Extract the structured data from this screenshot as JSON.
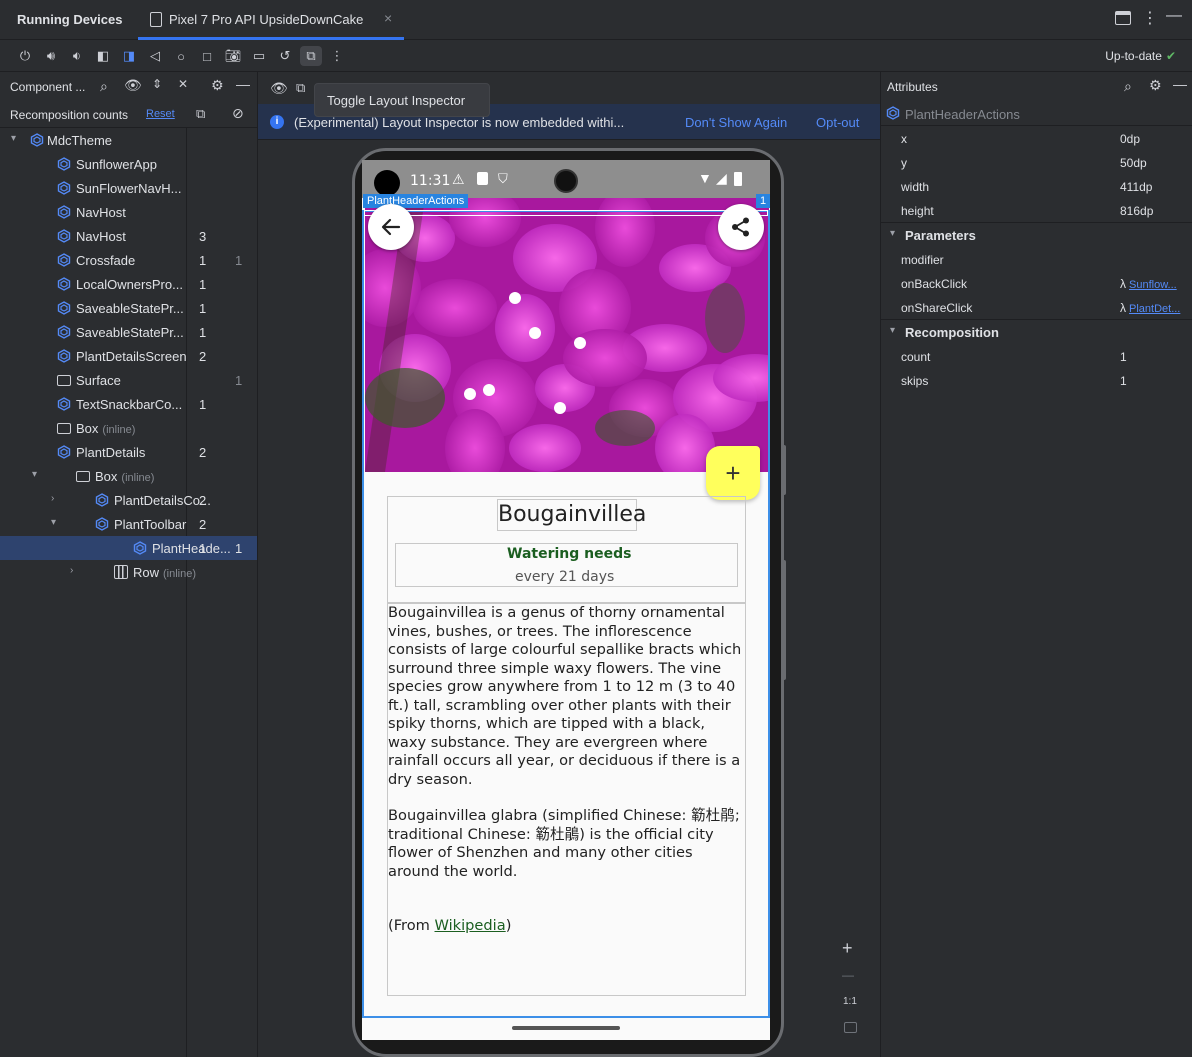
{
  "top": {
    "panel_title": "Running Devices",
    "device_tab": "Pixel 7 Pro API UpsideDownCake",
    "close_symbol": "×",
    "status": "Up-to-date",
    "status_check": "✔"
  },
  "left": {
    "header_title": "Component ...",
    "sub_title": "Recomposition counts",
    "reset_label": "Reset",
    "tree": [
      {
        "name": "MdcTheme",
        "icon": "compose-icon",
        "arrow": "▾",
        "c1": "",
        "c2": "",
        "indent": 0
      },
      {
        "name": "SunflowerApp",
        "icon": "compose-icon",
        "arrow": "",
        "c1": "",
        "c2": "",
        "indent": 1
      },
      {
        "name": "SunFlowerNavH...",
        "icon": "compose-icon",
        "arrow": "",
        "c1": "",
        "c2": "",
        "indent": 1
      },
      {
        "name": "NavHost",
        "icon": "compose-icon",
        "arrow": "",
        "c1": "",
        "c2": "",
        "indent": 1
      },
      {
        "name": "NavHost",
        "icon": "compose-icon",
        "arrow": "",
        "c1": "3",
        "c2": "",
        "indent": 1
      },
      {
        "name": "Crossfade",
        "icon": "compose-icon",
        "arrow": "",
        "c1": "1",
        "c2": "1",
        "indent": 1
      },
      {
        "name": "LocalOwnersPro...",
        "icon": "compose-icon",
        "arrow": "",
        "c1": "1",
        "c2": "",
        "indent": 1
      },
      {
        "name": "SaveableStatePr...",
        "icon": "compose-icon",
        "arrow": "",
        "c1": "1",
        "c2": "",
        "indent": 1
      },
      {
        "name": "SaveableStatePr...",
        "icon": "compose-icon",
        "arrow": "",
        "c1": "1",
        "c2": "",
        "indent": 1
      },
      {
        "name": "PlantDetailsScreen",
        "icon": "compose-icon",
        "arrow": "",
        "c1": "2",
        "c2": "",
        "indent": 1
      },
      {
        "name": "Surface",
        "icon": "box-icon",
        "arrow": "",
        "c1": "",
        "c2": "1",
        "indent": 1
      },
      {
        "name": "TextSnackbarCo...",
        "icon": "compose-icon",
        "arrow": "",
        "c1": "1",
        "c2": "",
        "indent": 1
      },
      {
        "name": "Box",
        "inline": "(inline)",
        "icon": "box-icon",
        "arrow": "",
        "c1": "",
        "c2": "",
        "indent": 1
      },
      {
        "name": "PlantDetails",
        "icon": "compose-icon",
        "arrow": "",
        "c1": "2",
        "c2": "",
        "indent": 1
      },
      {
        "name": "Box",
        "inline": "(inline)",
        "icon": "box-icon",
        "arrow": "▾",
        "c1": "",
        "c2": "",
        "indent": 2
      },
      {
        "name": "PlantDetailsCo...",
        "icon": "compose-icon",
        "arrow": "›",
        "c1": "2",
        "c2": "",
        "indent": 3
      },
      {
        "name": "PlantToolbar",
        "icon": "compose-icon",
        "arrow": "▾",
        "c1": "2",
        "c2": "",
        "indent": 3
      },
      {
        "name": "PlantHeade...",
        "icon": "compose-icon",
        "arrow": "",
        "c1": "1",
        "c2": "1",
        "indent": 5,
        "selected": true
      },
      {
        "name": "Row",
        "inline": "(inline)",
        "icon": "row-icon",
        "arrow": "›",
        "c1": "",
        "c2": "",
        "indent": 4
      }
    ]
  },
  "center": {
    "tooltip": "Toggle Layout Inspector",
    "banner_msg": "(Experimental) Layout Inspector is now embedded withi...",
    "banner_link1": "Don't Show Again",
    "banner_link2": "Opt-out",
    "zoom_in": "+",
    "zoom_out": "—",
    "zoom_reset": "1:1"
  },
  "device": {
    "time": "11:31",
    "inspect_label": "PlantHeaderActions",
    "inspect_count": "1",
    "plant_name": "Bougainvillea",
    "watering_title": "Watering needs",
    "watering_sub": "every 21 days",
    "description_p1": "Bougainvillea is a genus of thorny ornamental vines, bushes, or trees. The inflorescence consists of large colourful sepallike bracts which surround three simple waxy flowers. The vine species grow anywhere from 1 to 12 m (3 to 40 ft.) tall, scrambling over other plants with their spiky thorns, which are tipped with a black, waxy substance. They are evergreen where rainfall occurs all year, or deciduous if there is a dry season.",
    "description_p2": "Bougainvillea glabra (simplified Chinese: 簕杜鹃; traditional Chinese: 簕杜鵑) is the official city flower of Shenzhen and many other cities around the world.",
    "from_prefix": "(From ",
    "from_link": "Wikipedia",
    "from_suffix": ")",
    "fab_symbol": "+"
  },
  "right": {
    "header_title": "Attributes",
    "selected_component": "PlantHeaderActions",
    "attrs": [
      {
        "key": "x",
        "value": "0dp"
      },
      {
        "key": "y",
        "value": "50dp"
      },
      {
        "key": "width",
        "value": "411dp"
      },
      {
        "key": "height",
        "value": "816dp"
      }
    ],
    "params_title": "Parameters",
    "params": [
      {
        "key": "modifier",
        "value": "",
        "link": ""
      },
      {
        "key": "onBackClick",
        "value": "λ",
        "link": "Sunflow..."
      },
      {
        "key": "onShareClick",
        "value": "λ",
        "link": "PlantDet..."
      }
    ],
    "recomp_title": "Recomposition",
    "recomp": [
      {
        "key": "count",
        "value": "1"
      },
      {
        "key": "skips",
        "value": "1"
      }
    ]
  },
  "colors": {
    "accent": "#3574f0",
    "selection": "#2e436e",
    "fab": "#ffff5c",
    "watering_green": "#1b5e20",
    "inspect_blue": "#2884e0"
  }
}
